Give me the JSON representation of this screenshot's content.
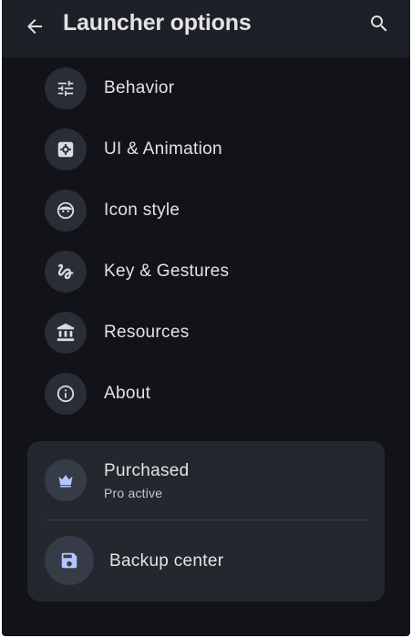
{
  "appbar": {
    "title": "Launcher options",
    "back_icon": "arrow-back-icon",
    "search_icon": "search-icon"
  },
  "menu": {
    "items": [
      {
        "label": "Behavior",
        "icon": "tune-sliders-icon"
      },
      {
        "label": "UI & Animation",
        "icon": "settings-gear-icon"
      },
      {
        "label": "Icon style",
        "icon": "face-icon"
      },
      {
        "label": "Key & Gestures",
        "icon": "gesture-icon"
      },
      {
        "label": "Resources",
        "icon": "bank-building-icon"
      },
      {
        "label": "About",
        "icon": "info-icon"
      }
    ]
  },
  "card": {
    "purchased_label": "Purchased",
    "purchased_sub": "Pro active",
    "purchased_icon": "crown-icon",
    "backup_label": "Backup center",
    "backup_icon": "save-floppy-icon"
  },
  "colors": {
    "background": "#111318",
    "appbar": "#1d2027",
    "card": "#24272e",
    "icon_circle": "#2a2d35",
    "accent_icon": "#b4c5ff",
    "text": "#e3e3e6"
  }
}
